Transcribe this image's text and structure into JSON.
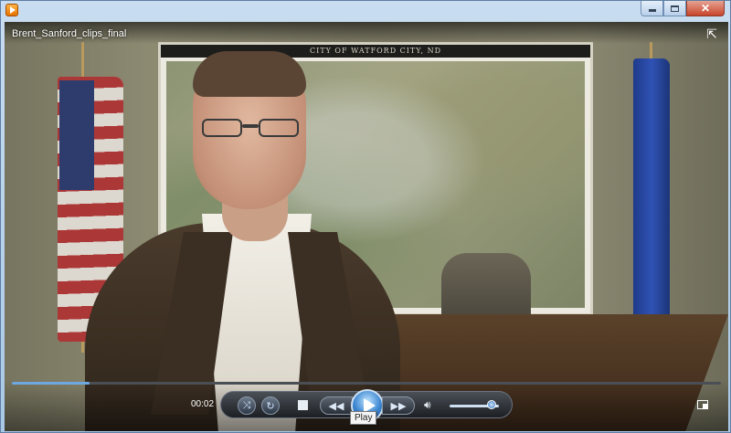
{
  "window": {
    "title": "Brent_Sanford_clips_final",
    "caption_buttons": [
      "minimize-icon",
      "maximize-icon",
      "close-icon"
    ]
  },
  "video": {
    "map_header": "CITY OF WATFORD CITY, ND"
  },
  "player": {
    "elapsed_time": "00:02",
    "seek_progress": 0.11,
    "volume_level": 0.85,
    "tooltip": "Play",
    "icons": {
      "switch_view": "switch-to-library-icon",
      "shuffle": "shuffle-icon",
      "repeat": "repeat-icon",
      "stop": "stop-icon",
      "previous": "previous-icon",
      "play": "play-icon",
      "next": "next-icon",
      "mute": "volume-icon",
      "fullscreen": "fullscreen-icon"
    }
  }
}
